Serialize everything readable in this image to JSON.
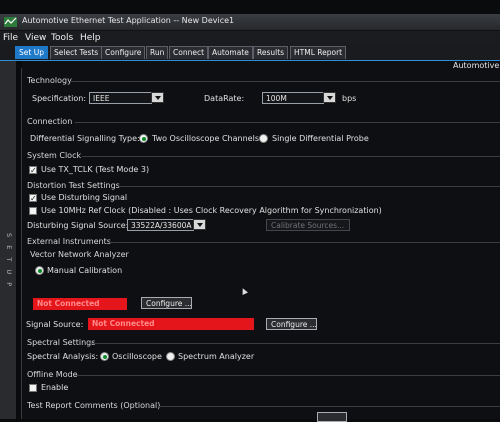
{
  "window": {
    "title": "Automotive Ethernet Test Application -- New Device1"
  },
  "menu": [
    "File",
    "View",
    "Tools",
    "Help"
  ],
  "tabs": [
    "Set Up",
    "Select Tests",
    "Configure",
    "Run",
    "Connect",
    "Automate",
    "Results",
    "HTML Report"
  ],
  "active_tab": "Set Up",
  "side_rail": "S E T   U P",
  "corner_label": "Automotive",
  "technology": {
    "heading": "Technology",
    "spec_label": "Specification:",
    "spec_value": "IEEE",
    "rate_label": "DataRate:",
    "rate_value": "100M",
    "rate_unit": "bps"
  },
  "connection": {
    "heading": "Connection",
    "diff_label": "Differential Signalling Type:",
    "opt1": "Two Oscilloscope Channels",
    "opt2": "Single Differential Probe",
    "selected": "Two Oscilloscope Channels"
  },
  "system_clock": {
    "heading": "System Clock",
    "tclk_label": "Use TX_TCLK (Test Mode 3)",
    "tclk_checked": true
  },
  "distortion": {
    "heading": "Distortion Test Settings",
    "use_disturbing": "Use Disturbing Signal",
    "use_disturbing_checked": true,
    "use_10mhz": "Use 10MHz Ref Clock (Disabled : Uses Clock Recovery Algorithm for Synchronization)",
    "use_10mhz_checked": false,
    "source_label": "Disturbing Signal Source:",
    "source_value": "33522A/33600A",
    "calibrate": "Calibrate Sources..."
  },
  "external": {
    "heading": "External Instruments",
    "vna_heading": "Vector Network Analyzer",
    "manual_cal": "Manual Calibration",
    "vna_status": "Not Connected",
    "configure": "Configure ...",
    "sig_label": "Signal Source:",
    "sig_status": "Not Connected",
    "configure2": "Configure ..."
  },
  "spectral": {
    "heading": "Spectral Settings",
    "label": "Spectral Analysis:",
    "opt1": "Oscilloscope",
    "opt2": "Spectrum Analyzer",
    "selected": "Oscilloscope"
  },
  "offline": {
    "heading": "Offline Mode",
    "enable": "Enable",
    "enable_checked": false
  },
  "report": {
    "heading": "Test Report Comments (Optional)"
  },
  "colors": {
    "accent": "#1f79c9",
    "status_red": "#e5161b",
    "radio_on": "#0a8a2a"
  }
}
